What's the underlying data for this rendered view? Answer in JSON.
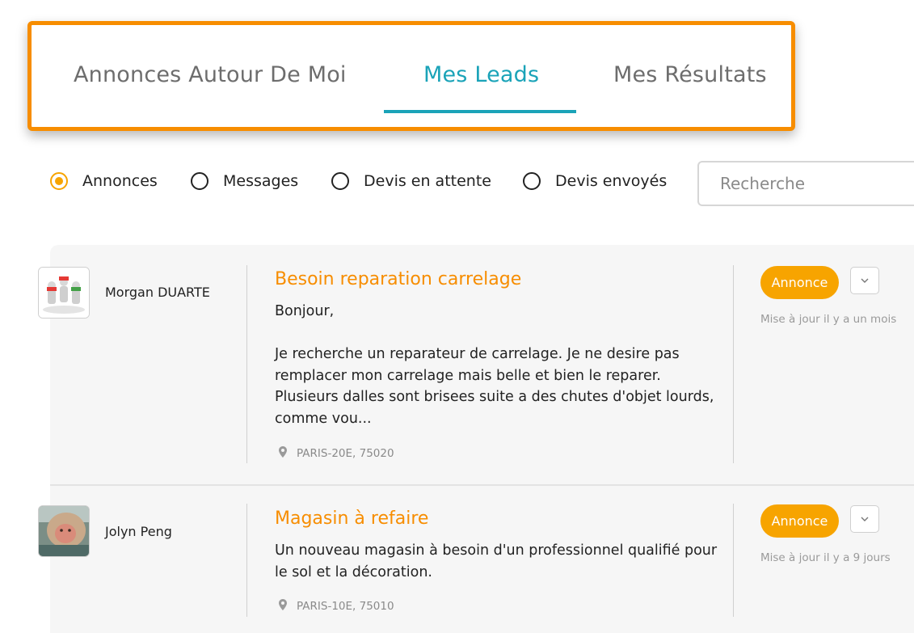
{
  "tabs": [
    {
      "label": "Annonces Autour De Moi"
    },
    {
      "label": "Mes Leads",
      "active": true
    },
    {
      "label": "Mes Résultats"
    }
  ],
  "filters": {
    "options": [
      "Annonces",
      "Messages",
      "Devis en attente",
      "Devis envoyés"
    ],
    "selected": "Annonces"
  },
  "search": {
    "placeholder": "Recherche",
    "value": ""
  },
  "leads": [
    {
      "author": "Morgan DUARTE",
      "avatar_icon": "group-figures-icon",
      "title": "Besoin reparation carrelage",
      "body": "Bonjour,\n\nJe recherche un reparateur de carrelage. Je ne desire pas remplacer mon carrelage mais belle et bien le reparer. Plusieurs dalles sont brisees suite a des chutes d'objet lourds, comme vou...",
      "location": "PARIS-20E, 75020",
      "badge": "Annonce",
      "updated": "Mise à jour il y a un mois"
    },
    {
      "author": "Jolyn Peng",
      "avatar_icon": "monkey-photo-icon",
      "title": "Magasin à refaire",
      "body": "Un nouveau magasin à besoin d'un professionnel qualifié pour le sol et la décoration.",
      "location": "PARIS-10E, 75010",
      "badge": "Annonce",
      "updated": "Mise à jour il y a 9 jours"
    }
  ],
  "colors": {
    "accent_orange": "#f78d00",
    "badge": "#f7a400",
    "active_tab": "#1aa3b8"
  }
}
